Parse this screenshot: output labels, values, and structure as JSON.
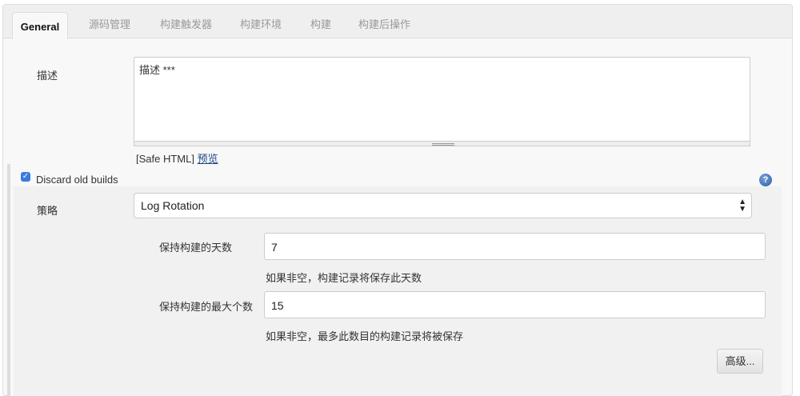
{
  "tabs": [
    "General",
    "源码管理",
    "构建触发器",
    "构建环境",
    "构建",
    "构建后操作"
  ],
  "description": {
    "label": "描述",
    "value": "描述 ***",
    "safe_html": "[Safe HTML]",
    "preview_link": "预览"
  },
  "discard": {
    "label": "Discard old builds",
    "checked": true
  },
  "strategy": {
    "label": "策略",
    "value": "Log Rotation"
  },
  "days": {
    "label": "保持构建的天数",
    "value": "7",
    "hint": "如果非空，构建记录将保存此天数"
  },
  "max": {
    "label": "保持构建的最大个数",
    "value": "15",
    "hint": "如果非空，最多此数目的构建记录将被保存"
  },
  "advanced_button": "高级..."
}
